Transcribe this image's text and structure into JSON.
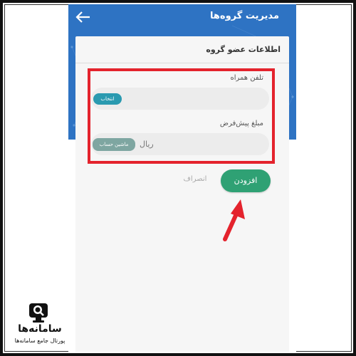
{
  "header": {
    "title": "مدیریت گروه‌ها",
    "back_icon": "back-arrow-icon"
  },
  "card": {
    "title": "اطلاعات عضو گروه"
  },
  "form": {
    "phone_label": "تلفن همراه",
    "phone_value": "",
    "phone_select_label": "انتخاب",
    "amount_label": "مبلغ پیش‌فرض",
    "amount_value": "",
    "amount_unit": "ریال",
    "calculator_label": "ماشین حساب"
  },
  "actions": {
    "add_label": "افزودن",
    "cancel_label": "انصراف"
  },
  "annotation": {
    "highlight_color": "#e4232d",
    "arrow_color": "#e4232d"
  },
  "logo": {
    "name": "سامانه‌ها",
    "subtitle": "پورتال جامع سامانه‌ها"
  },
  "colors": {
    "appbar": "#2e73c3",
    "primary_button": "#2fa174",
    "chip_select": "#2a9ab0",
    "chip_calculator": "#7ea6a1"
  }
}
